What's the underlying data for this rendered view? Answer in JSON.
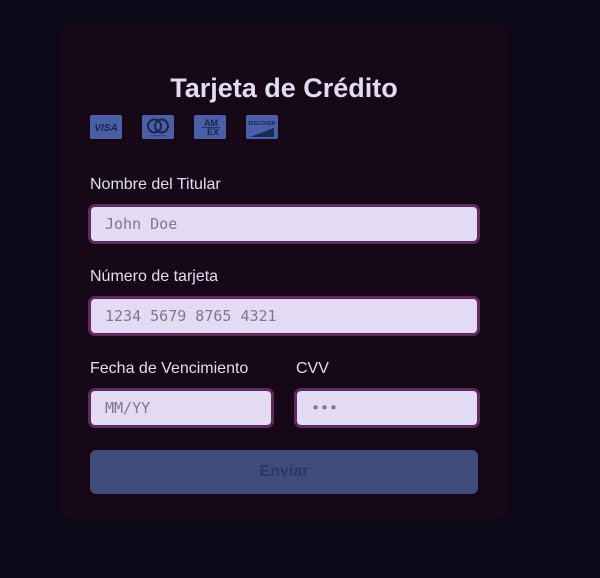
{
  "form": {
    "title": "Tarjeta de Crédito",
    "brands": [
      {
        "icon": "visa-icon",
        "text": "VISA"
      },
      {
        "icon": "mastercard-icon",
        "text": "mastercard"
      },
      {
        "icon": "amex-icon",
        "text": "AM EX"
      },
      {
        "icon": "discover-icon",
        "text": "DISCOVER"
      }
    ],
    "holder": {
      "label": "Nombre del Titular",
      "placeholder": "John Doe",
      "value": ""
    },
    "number": {
      "label": "Número de tarjeta",
      "placeholder": "1234 5679 8765 4321",
      "value": ""
    },
    "expiry": {
      "label": "Fecha de Vencimiento",
      "placeholder": "MM/YY",
      "value": ""
    },
    "cvv": {
      "label": "CVV",
      "placeholder": "•••",
      "value": ""
    },
    "submit_label": "Enviar"
  },
  "colors": {
    "page_background": "#0b0818",
    "card_background": "#170818",
    "input_background": "#e3dbf4",
    "input_border": "#5f2a5d",
    "button_background": "#404c7b",
    "brand_icon": "#4a5fa6"
  }
}
